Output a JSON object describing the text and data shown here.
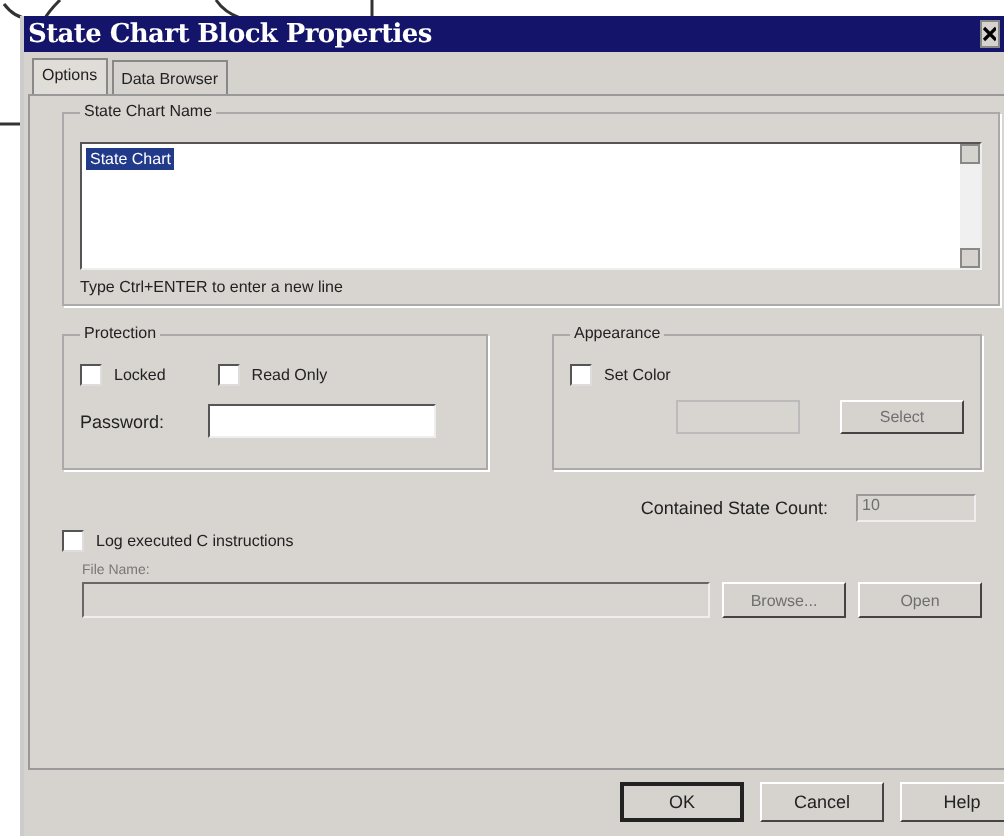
{
  "window": {
    "title": "State Chart Block Properties"
  },
  "tabs": [
    {
      "label": "Options",
      "selected": true
    },
    {
      "label": "Data Browser",
      "selected": false
    }
  ],
  "name_group": {
    "title": "State Chart Name",
    "value": "State Chart",
    "value_selected": true,
    "hint": "Type Ctrl+ENTER to enter a new line"
  },
  "protection": {
    "title": "Protection",
    "checkboxes": [
      {
        "label": "Locked",
        "checked": false
      },
      {
        "label": "Read Only",
        "checked": false
      }
    ],
    "password_label": "Password:"
  },
  "appearance": {
    "title": "Appearance",
    "set_color": {
      "label": "Set Color",
      "checked": false
    },
    "select_button": {
      "label": "Select",
      "disabled": true
    }
  },
  "state_count": {
    "label": "Contained State Count:",
    "value": "10",
    "disabled": true
  },
  "log": {
    "label": "Log executed C instructions",
    "checked": false
  },
  "file": {
    "label": "File Name:",
    "disabled": true,
    "buttons": [
      {
        "label": "Browse...",
        "disabled": true
      },
      {
        "label": "Open",
        "disabled": true
      }
    ]
  },
  "buttons": [
    {
      "label": "OK",
      "default": true
    },
    {
      "label": "Cancel",
      "default": false
    },
    {
      "label": "Help",
      "default": false
    }
  ]
}
